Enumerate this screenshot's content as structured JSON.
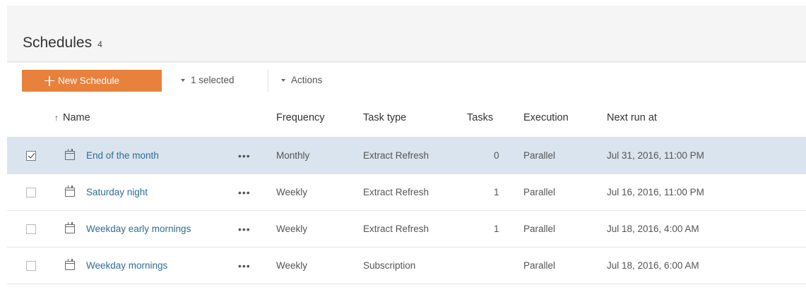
{
  "header": {
    "title": "Schedules",
    "count": "4"
  },
  "toolbar": {
    "new_label": "New Schedule",
    "selected_label": "1 selected",
    "actions_label": "Actions"
  },
  "table": {
    "columns": {
      "name": "Name",
      "frequency": "Frequency",
      "task_type": "Task type",
      "tasks": "Tasks",
      "execution": "Execution",
      "next_run": "Next run at"
    },
    "rows": [
      {
        "checked": true,
        "name": "End of the month",
        "menu": "•••",
        "frequency": "Monthly",
        "task_type": "Extract Refresh",
        "tasks": "0",
        "execution": "Parallel",
        "next_run": "Jul 31, 2016, 11:00 PM"
      },
      {
        "checked": false,
        "name": "Saturday night",
        "menu": "•••",
        "frequency": "Weekly",
        "task_type": "Extract Refresh",
        "tasks": "1",
        "execution": "Parallel",
        "next_run": "Jul 16, 2016, 11:00 PM"
      },
      {
        "checked": false,
        "name": "Weekday early mornings",
        "menu": "•••",
        "frequency": "Weekly",
        "task_type": "Extract Refresh",
        "tasks": "1",
        "execution": "Parallel",
        "next_run": "Jul 18, 2016, 4:00 AM"
      },
      {
        "checked": false,
        "name": "Weekday mornings",
        "menu": "•••",
        "frequency": "Weekly",
        "task_type": "Subscription",
        "tasks": "",
        "execution": "Parallel",
        "next_run": "Jul 18, 2016, 6:00 AM"
      }
    ]
  },
  "colors": {
    "accent": "#e8813c",
    "selected_row": "#d9e4ee",
    "link": "#2e6d94",
    "header_bg": "#f5f5f5"
  },
  "icons": {
    "add": "plus-icon",
    "dropdown": "caret-down-icon",
    "sort": "sort-ascending-icon",
    "schedule": "calendar-icon",
    "row_menu": "more-options-icon",
    "checkbox": "checkbox-icon"
  }
}
